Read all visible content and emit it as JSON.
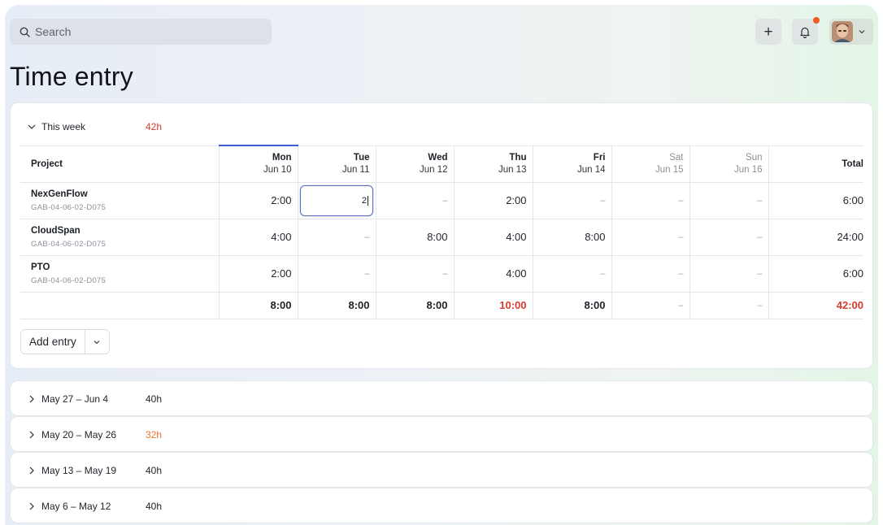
{
  "search": {
    "placeholder": "Search"
  },
  "header": {
    "add_label": "+",
    "title": "Time entry"
  },
  "current_week": {
    "label": "This week",
    "hours": "42h",
    "columns": {
      "project": "Project",
      "days": [
        {
          "day": "Mon",
          "date": "Jun 10"
        },
        {
          "day": "Tue",
          "date": "Jun 11"
        },
        {
          "day": "Wed",
          "date": "Jun 12"
        },
        {
          "day": "Thu",
          "date": "Jun 13"
        },
        {
          "day": "Fri",
          "date": "Jun 14"
        },
        {
          "day": "Sat",
          "date": "Jun 15"
        },
        {
          "day": "Sun",
          "date": "Jun 16"
        }
      ],
      "total": "Total"
    },
    "rows": [
      {
        "name": "NexGenFlow",
        "code": "GAB-04-06-02-D075",
        "values": [
          "2:00",
          "2",
          "–",
          "2:00",
          "–",
          "–",
          "–"
        ],
        "total": "6:00"
      },
      {
        "name": "CloudSpan",
        "code": "GAB-04-06-02-D075",
        "values": [
          "4:00",
          "–",
          "8:00",
          "4:00",
          "8:00",
          "–",
          "–"
        ],
        "total": "24:00"
      },
      {
        "name": "PTO",
        "code": "GAB-04-06-02-D075",
        "values": [
          "2:00",
          "–",
          "–",
          "4:00",
          "–",
          "–",
          "–"
        ],
        "total": "6:00"
      }
    ],
    "totals": [
      "8:00",
      "8:00",
      "8:00",
      "10:00",
      "8:00",
      "–",
      "–"
    ],
    "grand_total": "42:00",
    "add_entry_label": "Add entry"
  },
  "past_weeks": [
    {
      "label": "May 27 – Jun 4",
      "hours": "40h"
    },
    {
      "label": "May 20 – May 26",
      "hours": "32h"
    },
    {
      "label": "May 13 – May 19",
      "hours": "40h"
    },
    {
      "label": "May 6 – May 12",
      "hours": "40h"
    }
  ],
  "colors": {
    "accent": "#3f5bd3",
    "over": "#d63b2d",
    "under": "#e8762b",
    "notification": "#ee5a24"
  }
}
